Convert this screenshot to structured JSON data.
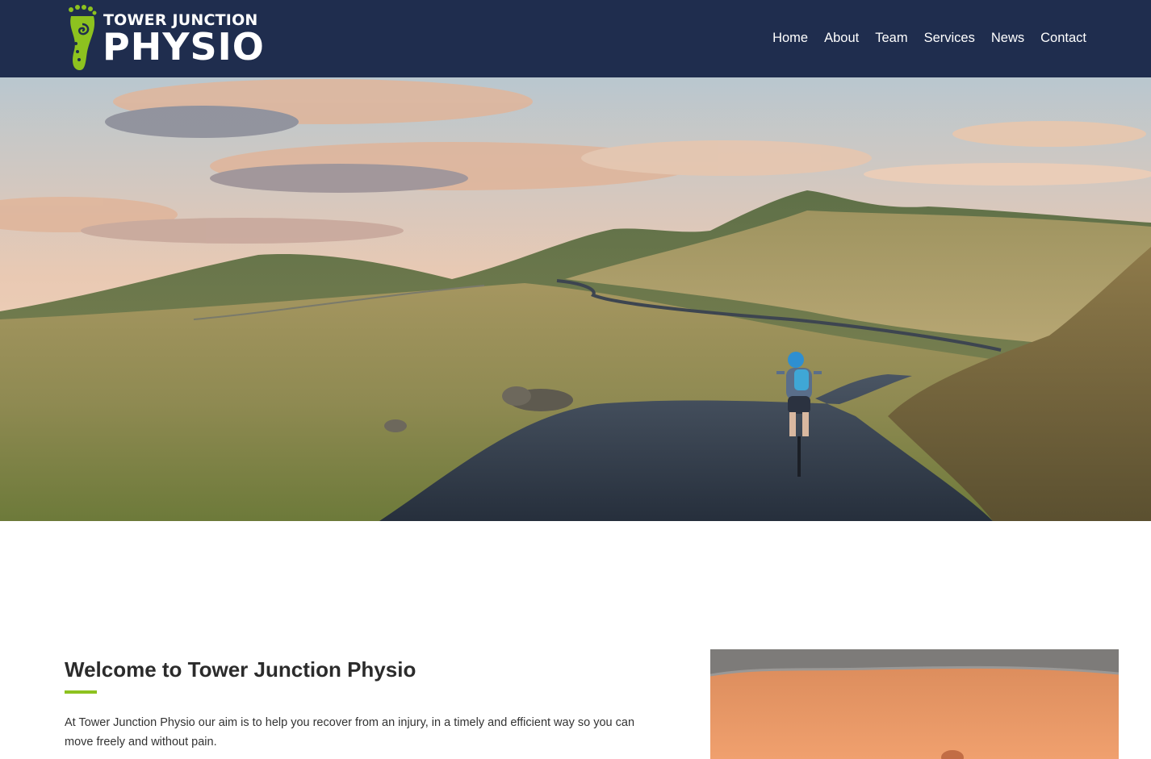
{
  "brand": {
    "line1": "TOWER JUNCTION",
    "line2": "PHYSIO",
    "logo_icon": "footprint-spiral-icon",
    "accent_color": "#8dc21f"
  },
  "nav": {
    "items": [
      {
        "label": "Home"
      },
      {
        "label": "About"
      },
      {
        "label": "Team"
      },
      {
        "label": "Services"
      },
      {
        "label": "News"
      },
      {
        "label": "Contact"
      }
    ]
  },
  "hero": {
    "image": "cyclist-on-mountain-road-photo"
  },
  "welcome": {
    "title": "Welcome to Tower Junction Physio",
    "body": "At Tower Junction Physio our aim is to help you recover from an injury, in a timely and efficient way so you can move freely and without pain."
  },
  "side_image": {
    "image": "back-treatment-photo"
  },
  "colors": {
    "header_bg": "#1f2d4e",
    "accent": "#8dc21f",
    "heading": "#2b2b2b"
  }
}
